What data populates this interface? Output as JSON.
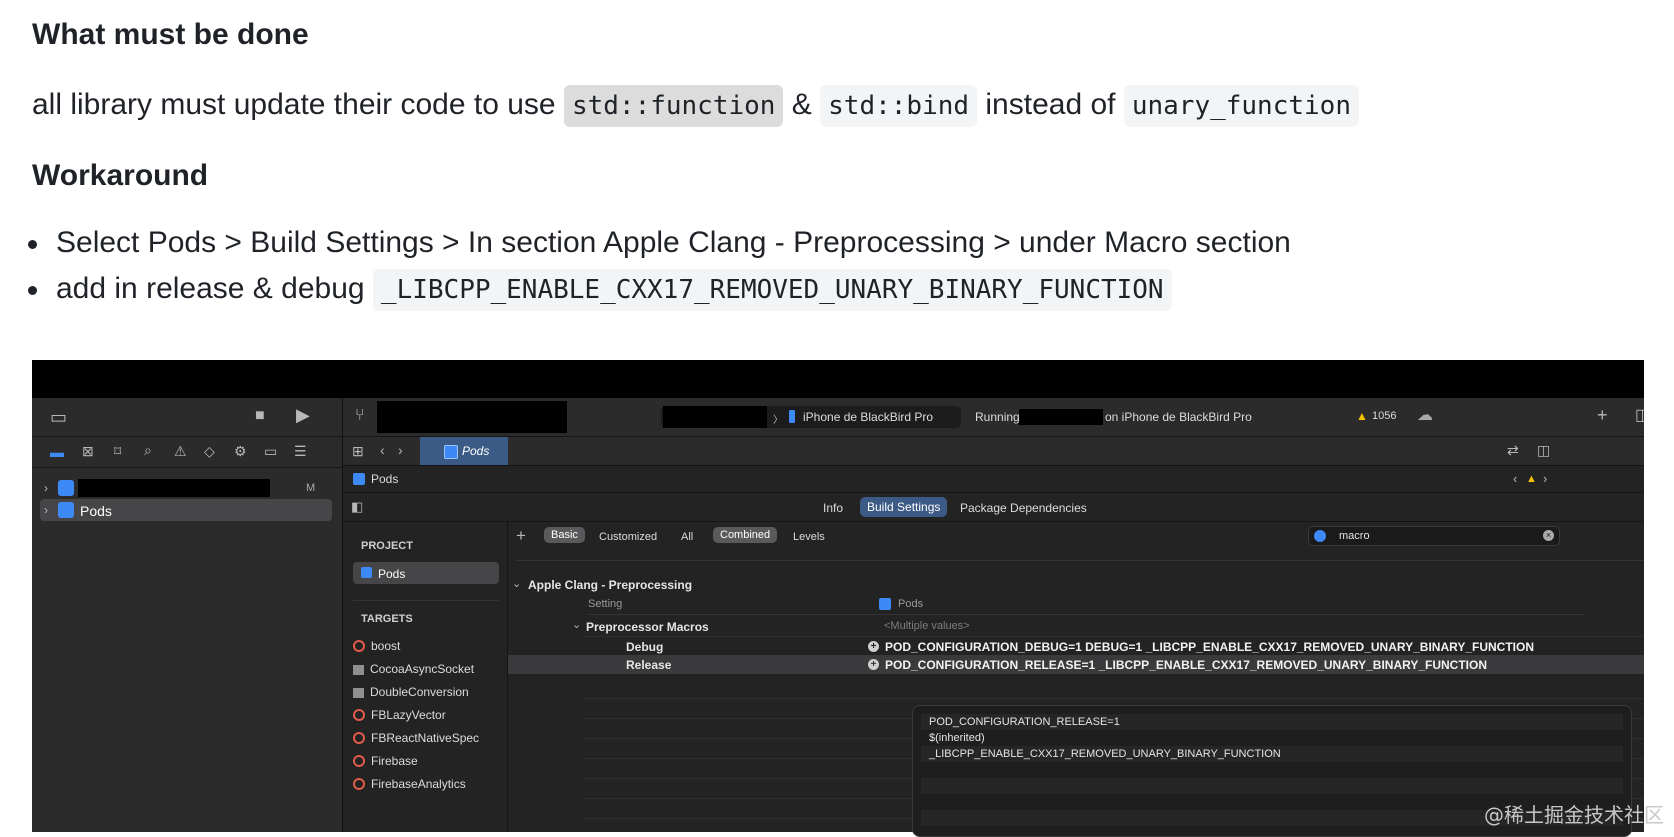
{
  "doc": {
    "heading1": "What must be done",
    "para_prefix": "all library must update their code to use",
    "code1": "std::function",
    "amp": "&",
    "code2": "std::bind",
    "instead_of": "instead of",
    "code3": "unary_function",
    "heading2": "Workaround",
    "bullet1": "Select Pods > Build Settings > In section Apple Clang - Preprocessing > under Macro section",
    "bullet2_prefix": "add in release & debug",
    "bullet2_code": "_LIBCPP_ENABLE_CXX17_REMOVED_UNARY_BINARY_FUNCTION"
  },
  "xcode": {
    "toolbar": {
      "scheme_arrow": "〉",
      "device": "iPhone de BlackBird Pro",
      "running": "Running",
      "running_on": "on iPhone de BlackBird Pro",
      "warnings": "1056"
    },
    "tab_pods": "Pods",
    "breadcrumb": "Pods",
    "navigator": {
      "project_modified": "M",
      "pods": "Pods"
    },
    "segments": {
      "info": "Info",
      "build_settings": "Build Settings",
      "package_deps": "Package Dependencies"
    },
    "filters": {
      "basic": "Basic",
      "customized": "Customized",
      "all": "All",
      "combined": "Combined",
      "levels": "Levels"
    },
    "search_value": "macro",
    "project_header": "PROJECT",
    "project_item": "Pods",
    "targets_header": "TARGETS",
    "targets": [
      {
        "name": "boost",
        "kind": "target"
      },
      {
        "name": "CocoaAsyncSocket",
        "kind": "lib"
      },
      {
        "name": "DoubleConversion",
        "kind": "lib"
      },
      {
        "name": "FBLazyVector",
        "kind": "target"
      },
      {
        "name": "FBReactNativeSpec",
        "kind": "target"
      },
      {
        "name": "Firebase",
        "kind": "target"
      },
      {
        "name": "FirebaseAnalytics",
        "kind": "target"
      }
    ],
    "section_title": "Apple Clang - Preprocessing",
    "col_setting": "Setting",
    "col_pods": "Pods",
    "preprocessor_macros": "Preprocessor Macros",
    "multiple_values": "<Multiple values>",
    "debug_label": "Debug",
    "debug_value": "POD_CONFIGURATION_DEBUG=1 DEBUG=1  _LIBCPP_ENABLE_CXX17_REMOVED_UNARY_BINARY_FUNCTION",
    "release_label": "Release",
    "release_value": "POD_CONFIGURATION_RELEASE=1  _LIBCPP_ENABLE_CXX17_REMOVED_UNARY_BINARY_FUNCTION",
    "popup_lines": [
      "POD_CONFIGURATION_RELEASE=1",
      "$(inherited)",
      "_LIBCPP_ENABLE_CXX17_REMOVED_UNARY_BINARY_FUNCTION"
    ]
  },
  "watermark": "@稀土掘金技术社区"
}
